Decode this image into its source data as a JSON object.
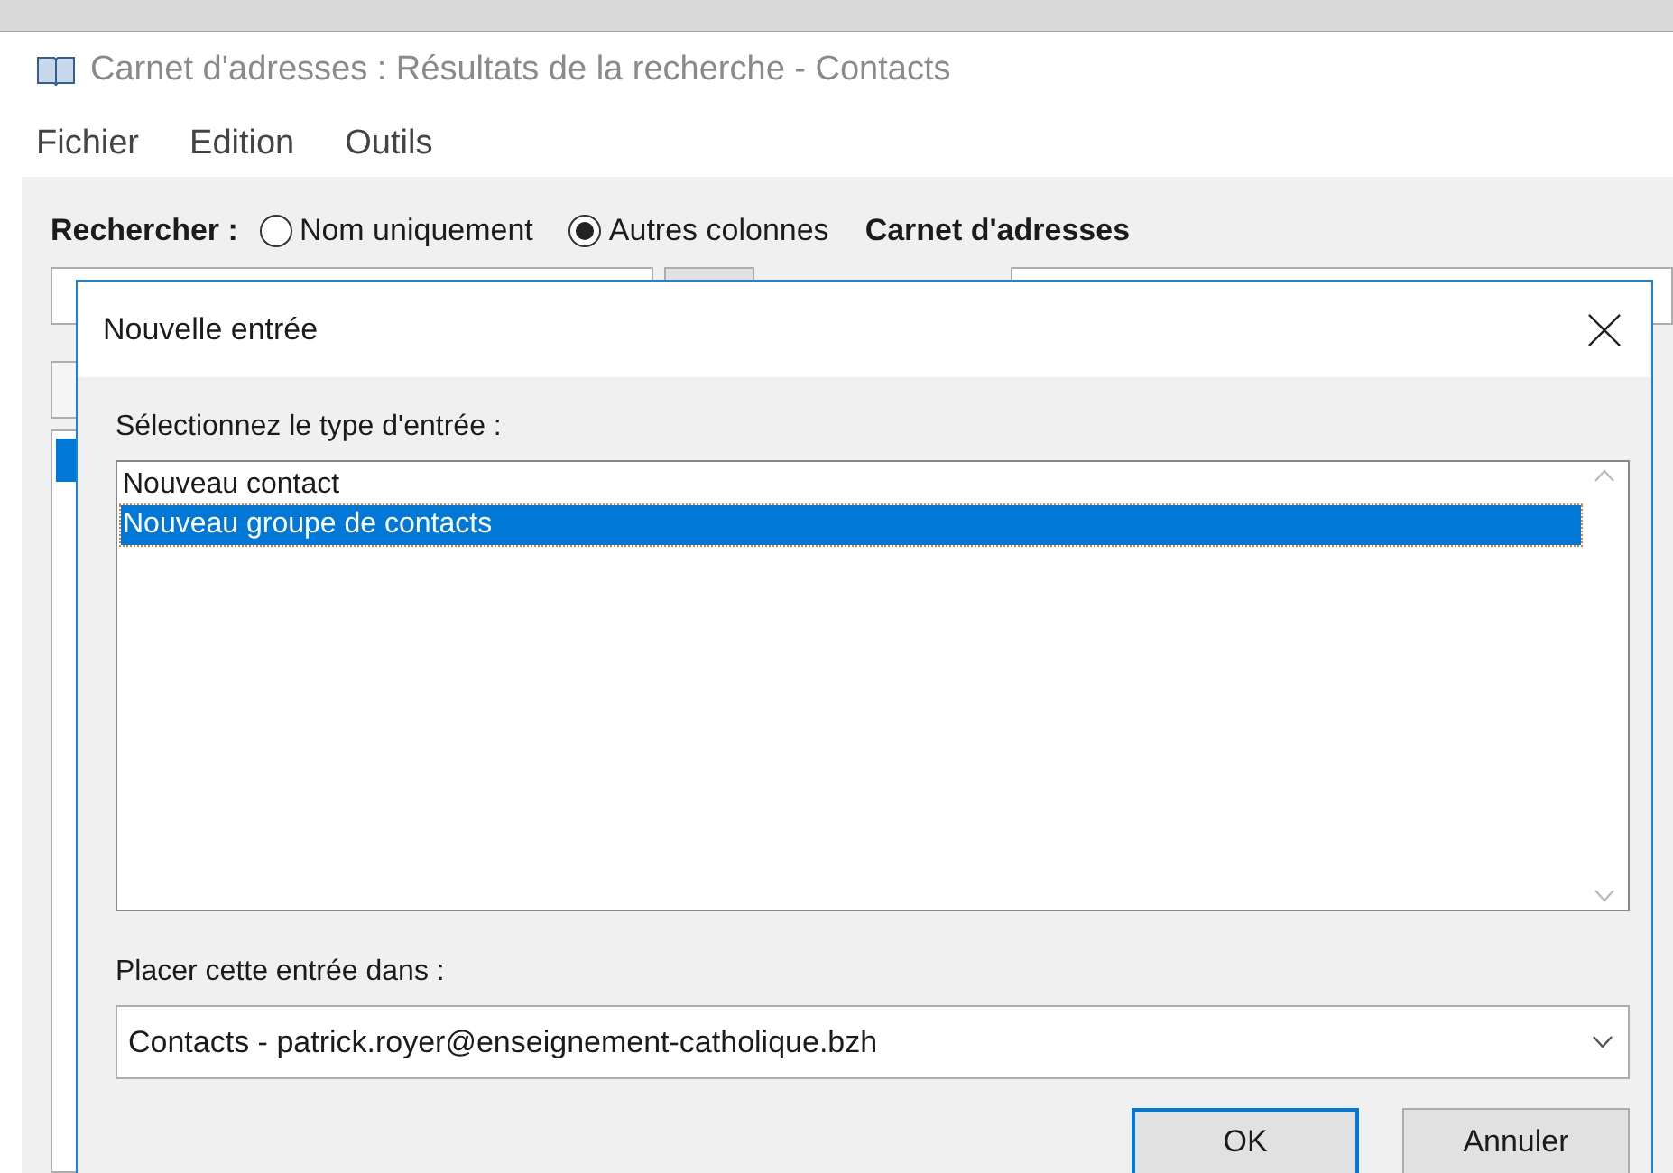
{
  "window": {
    "title": "Carnet d'adresses : Résultats de la recherche - Contacts"
  },
  "menu": [
    "Fichier",
    "Edition",
    "Outils"
  ],
  "search": {
    "label": "Rechercher :",
    "options": [
      {
        "label": "Nom uniquement",
        "selected": false
      },
      {
        "label": "Autres colonnes",
        "selected": true
      }
    ],
    "address_book_label": "Carnet d'adresses"
  },
  "dialog": {
    "title": "Nouvelle entrée",
    "type_label": "Sélectionnez le type d'entrée :",
    "entry_types": [
      {
        "label": "Nouveau contact",
        "selected": false
      },
      {
        "label": "Nouveau groupe de contacts",
        "selected": true
      }
    ],
    "place_label": "Placer cette entrée dans :",
    "place_value": "Contacts - patrick.royer@enseignement-catholique.bzh",
    "buttons": [
      {
        "label": "OK",
        "kind": "default"
      },
      {
        "label": "Annuler",
        "kind": "normal"
      }
    ]
  }
}
